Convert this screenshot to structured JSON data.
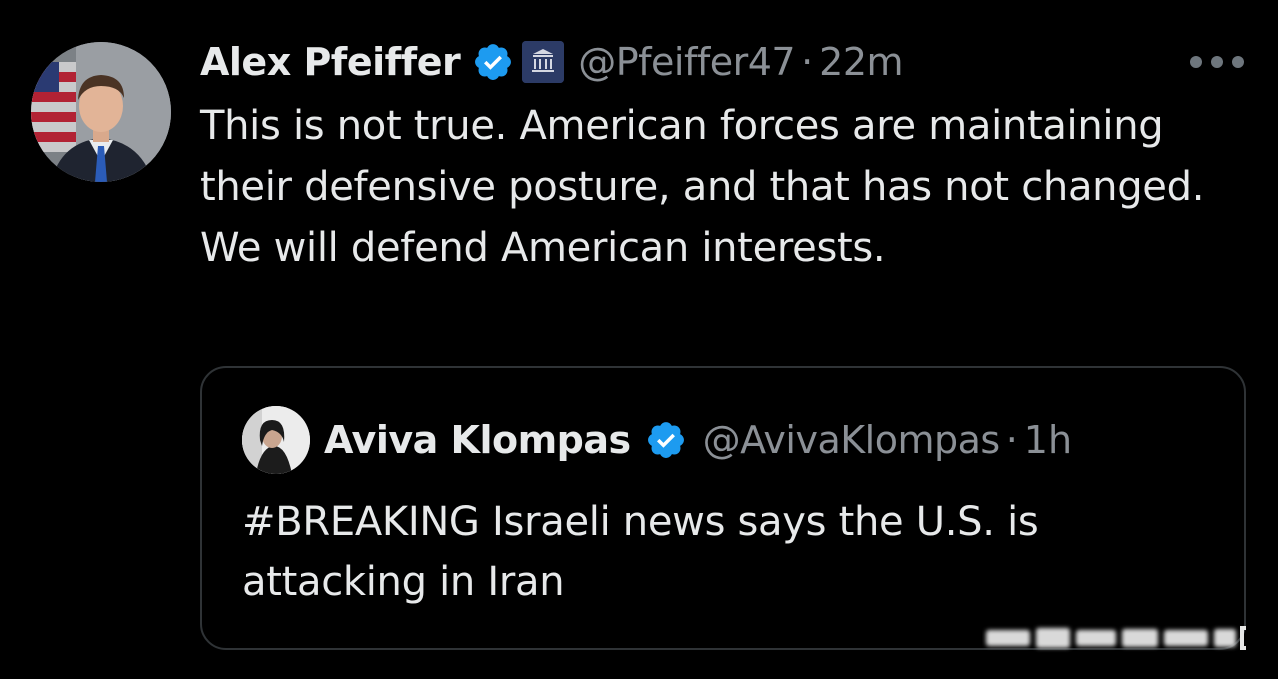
{
  "tweet": {
    "author_name": "Alex Pfeiffer",
    "handle": "@Pfeiffer47",
    "separator": "·",
    "time": "22m",
    "text": "This is not true. American forces are maintaining their defensive posture, and that has not changed. We will defend American interests.",
    "avatar_icon": "profile-photo",
    "verified_icon": "verified-badge-icon",
    "affiliation_icon": "white-house-affiliation-icon",
    "more_icon": "more-options-icon"
  },
  "quote": {
    "author_name": "Aviva Klompas",
    "handle": "@AvivaKlompas",
    "separator": "·",
    "time": "1h",
    "text": "#BREAKING Israeli news says the U.S. is attacking in Iran",
    "avatar_icon": "profile-photo",
    "verified_icon": "verified-badge-icon"
  },
  "colors": {
    "background": "#000000",
    "primary_text": "#e7e9ea",
    "secondary_text": "#8b9096",
    "verified_blue": "#1d9bf0",
    "card_border": "#2f3336"
  }
}
